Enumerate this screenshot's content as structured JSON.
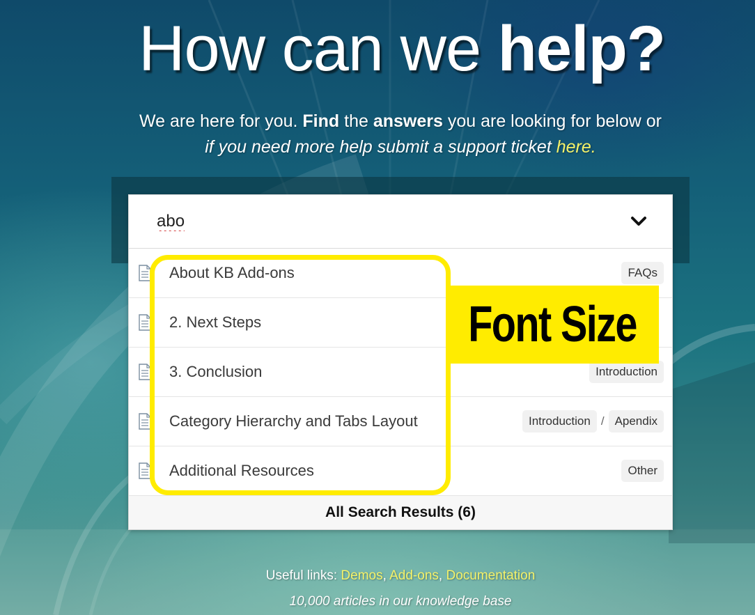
{
  "hero": {
    "title_part1": "How can we ",
    "title_part2": "help?",
    "subtitle": {
      "s1": "We are here for you. ",
      "s2": "Find",
      "s3": " the ",
      "s4": "answers",
      "s5": " you are looking for below or",
      "s6": "if you need more help submit a support ticket ",
      "link": "here."
    }
  },
  "search": {
    "query": "abo",
    "toggle_icon": "chevron-down-icon"
  },
  "results": [
    {
      "title": "About KB Add-ons",
      "tags": [
        "FAQs"
      ]
    },
    {
      "title": "2. Next Steps",
      "tags": []
    },
    {
      "title": "3. Conclusion",
      "tags": [
        "Introduction"
      ]
    },
    {
      "title": "Category Hierarchy and Tabs Layout",
      "tags": [
        "Introduction",
        "Apendix"
      ]
    },
    {
      "title": "Additional Resources",
      "tags": [
        "Other"
      ]
    }
  ],
  "result_icon": "document-icon",
  "all_results_label": "All Search Results (6)",
  "annotation": {
    "label": "Font Size",
    "color": "#ffec00"
  },
  "footer": {
    "useful_prefix": "Useful links: ",
    "links": [
      "Demos",
      "Add-ons",
      "Documentation"
    ],
    "separator": ", ",
    "article_count": "10,000 articles in our knowledge base"
  },
  "colors": {
    "link_yellow": "#f4f26a",
    "background_teal": "#1c7380"
  }
}
